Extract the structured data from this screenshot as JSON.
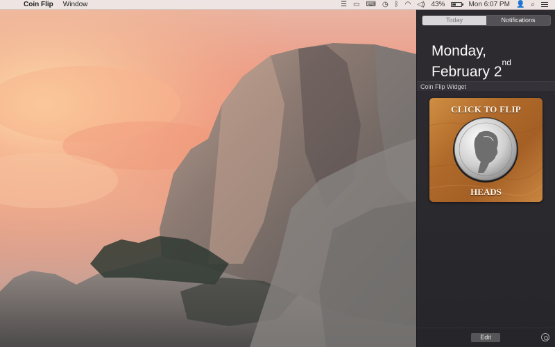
{
  "menubar": {
    "apple_icon": "apple-icon",
    "app_name": "Coin Flip",
    "menus": [
      "Window"
    ],
    "battery_percent": "43%",
    "battery_level": 0.43,
    "clock": "Mon 6:07 PM"
  },
  "notification_center": {
    "tabs": [
      {
        "label": "Today",
        "selected": false
      },
      {
        "label": "Notifications",
        "selected": true
      }
    ],
    "date_line1": "Monday,",
    "date_line2": "February 2",
    "date_suffix": "nd",
    "section_title": "Coin Flip Widget",
    "widget": {
      "prompt": "CLICK TO FLIP",
      "result": "HEADS"
    },
    "edit_label": "Edit"
  },
  "colors": {
    "panel_bg": "#2d2b30",
    "wood": "#b06a2a",
    "menubar_bg": "#eee8e8"
  }
}
